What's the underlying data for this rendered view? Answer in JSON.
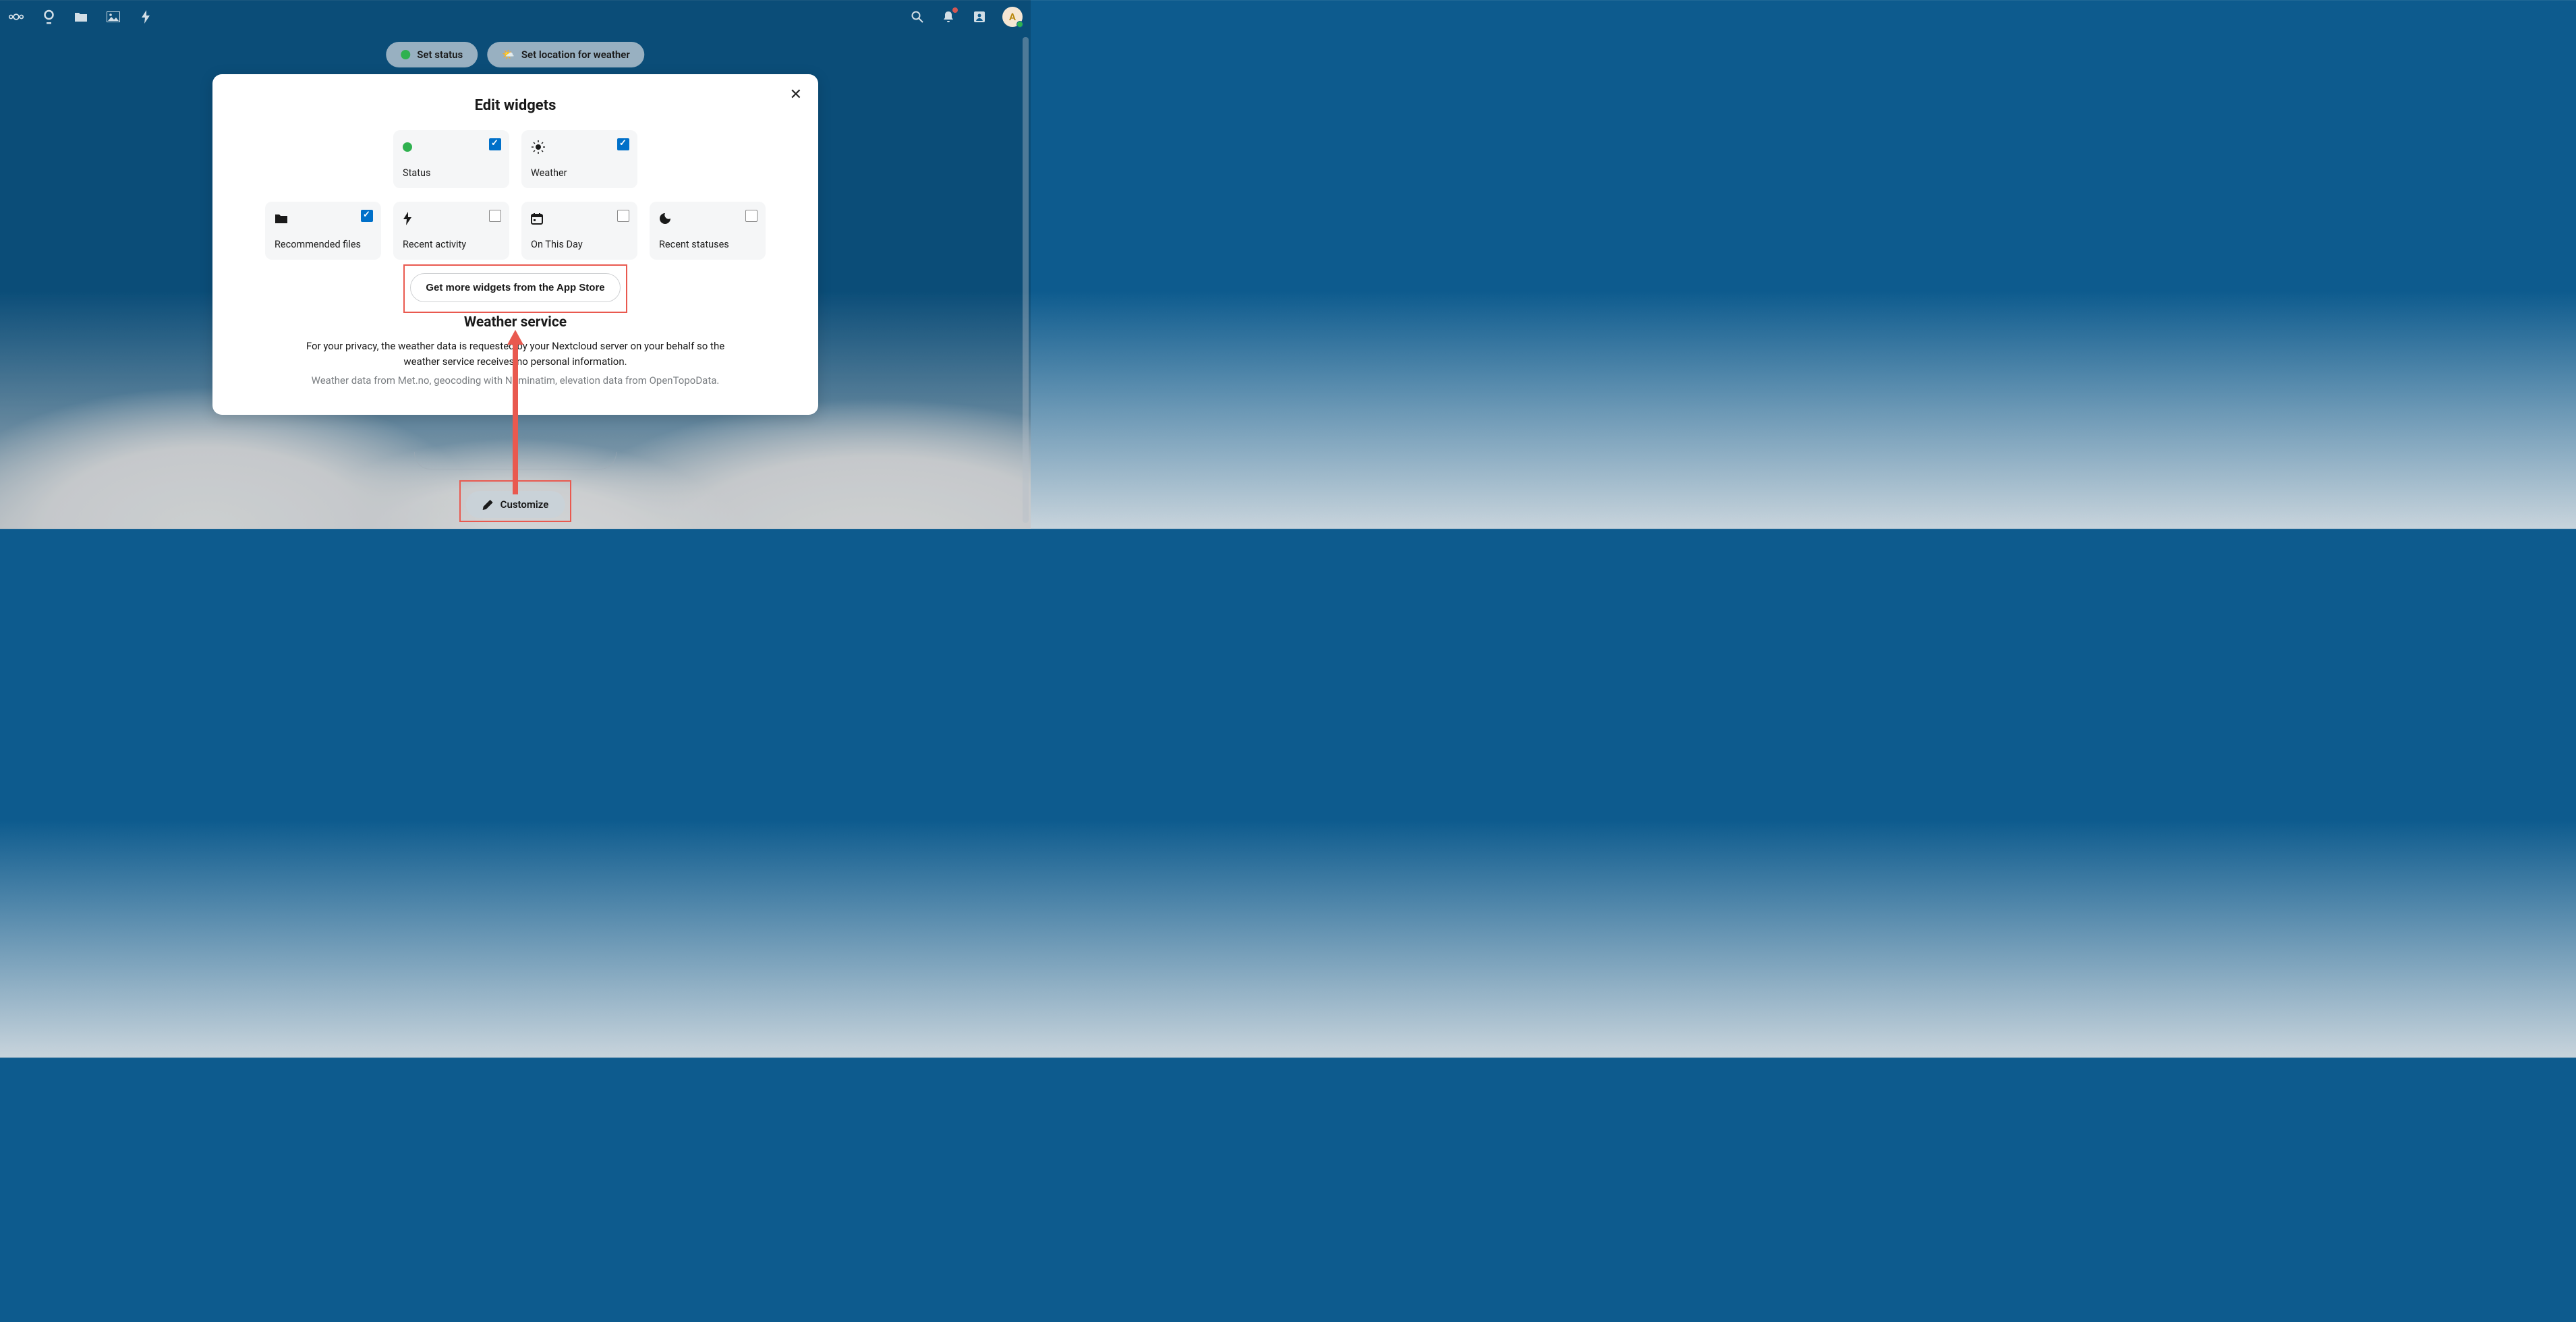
{
  "topbar": {
    "avatar_letter": "A"
  },
  "pills": {
    "set_status": "Set status",
    "set_weather": "Set location for weather"
  },
  "customize": {
    "label": "Customize"
  },
  "modal": {
    "title": "Edit widgets",
    "appstore_label": "Get more widgets from the App Store",
    "weather_service_title": "Weather service",
    "weather_desc": "For your privacy, the weather data is requested by your Nextcloud server on your behalf so the weather service receives no personal information.",
    "weather_attrib": "Weather data from Met.no, geocoding with Nominatim, elevation data from OpenTopoData.",
    "widgets_row1": [
      {
        "label": "Status",
        "checked": true,
        "icon": "status-dot"
      },
      {
        "label": "Weather",
        "checked": true,
        "icon": "sun"
      }
    ],
    "widgets_row2": [
      {
        "label": "Recommended files",
        "checked": true,
        "icon": "folder"
      },
      {
        "label": "Recent activity",
        "checked": false,
        "icon": "bolt"
      },
      {
        "label": "On This Day",
        "checked": false,
        "icon": "calendar"
      },
      {
        "label": "Recent statuses",
        "checked": false,
        "icon": "moon"
      }
    ]
  }
}
